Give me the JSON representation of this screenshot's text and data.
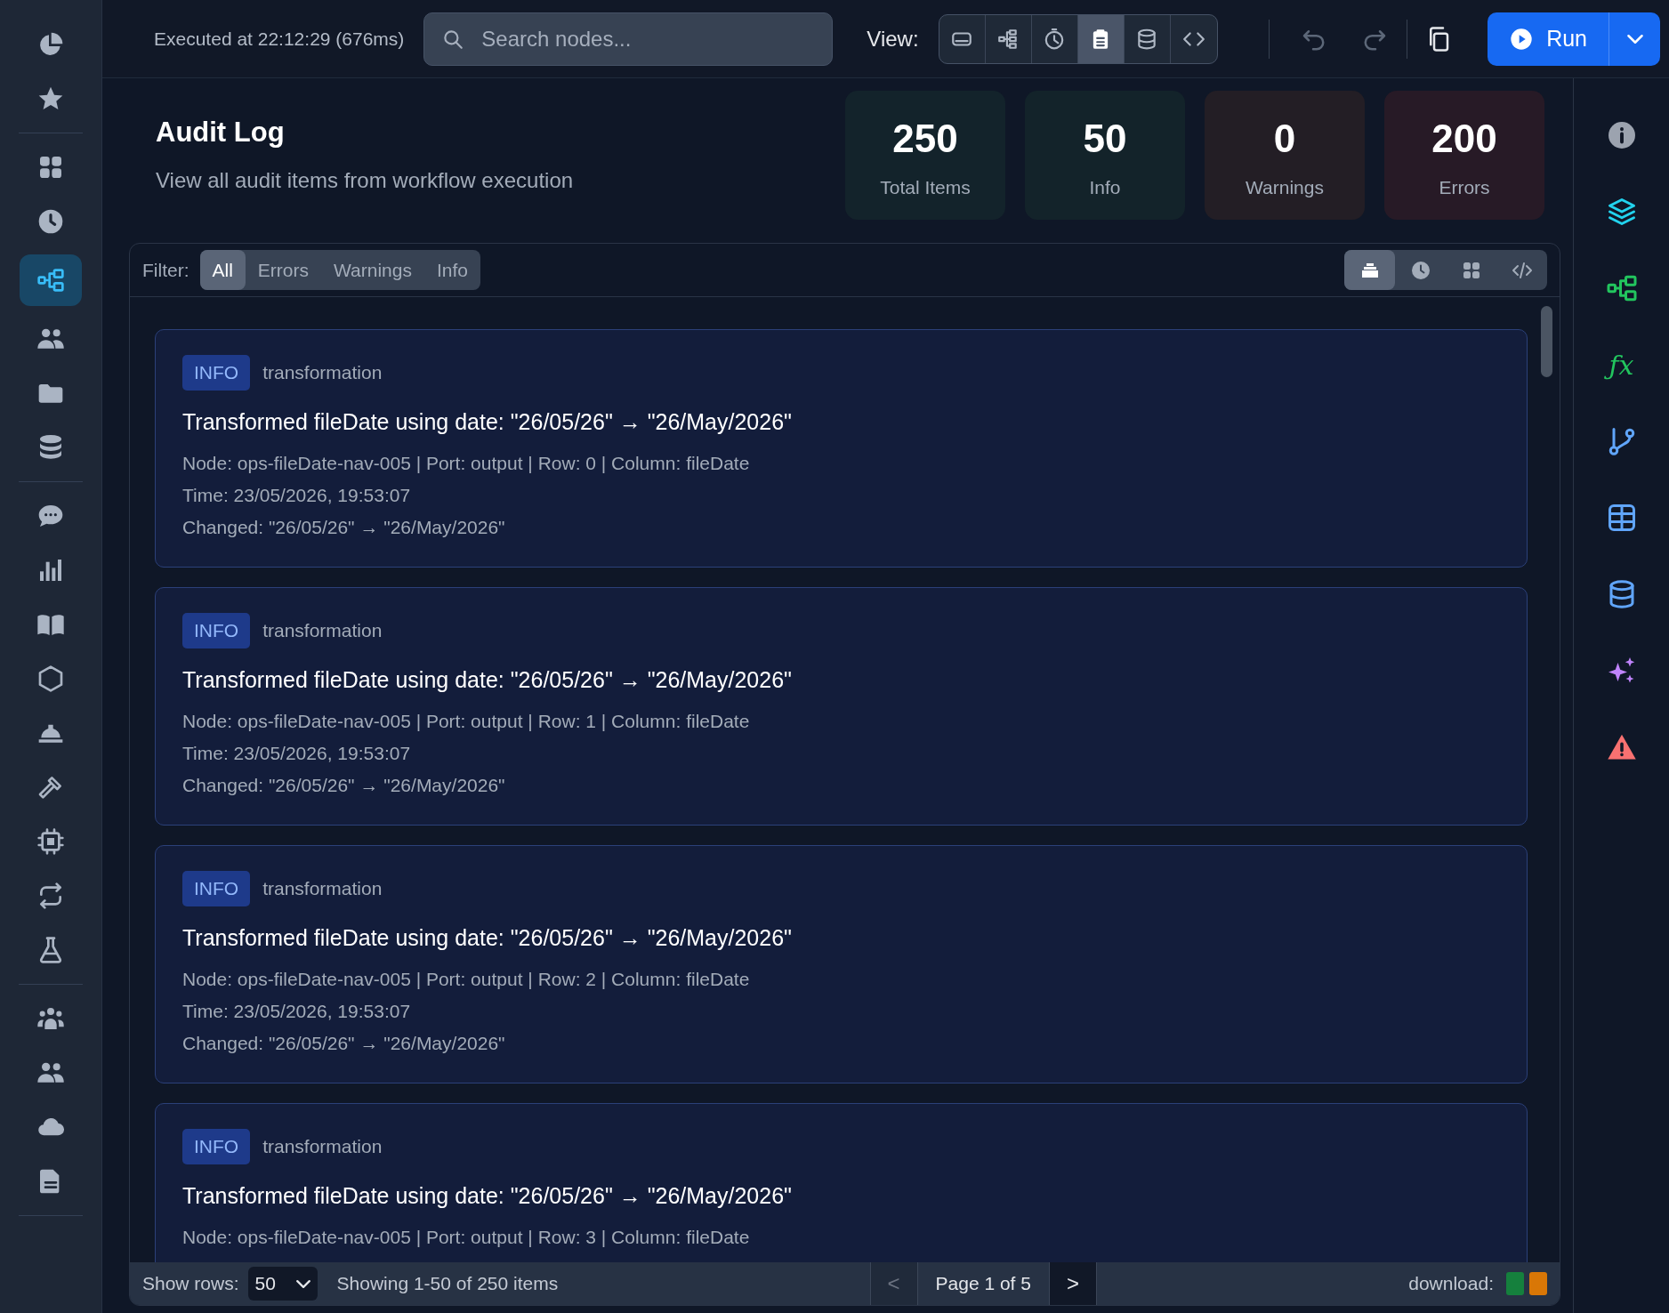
{
  "topbar": {
    "executed": "Executed at 22:12:29 (676ms)",
    "search": {
      "placeholder": "Search nodes..."
    },
    "view_label": "View:",
    "view_buttons": [
      {
        "selected": false
      },
      {
        "selected": false
      },
      {
        "selected": false
      },
      {
        "selected": true
      },
      {
        "selected": false
      },
      {
        "selected": false
      }
    ],
    "run_button": "Run"
  },
  "left_sidebar": {
    "groups": [
      [
        {
          "selected": false
        },
        {
          "selected": false
        }
      ],
      [
        {
          "selected": false
        },
        {
          "selected": false
        },
        {
          "selected": true
        },
        {
          "selected": false
        },
        {
          "selected": false
        },
        {
          "selected": false
        }
      ],
      [
        {
          "selected": false
        },
        {
          "selected": false
        },
        {
          "selected": false
        },
        {
          "selected": false
        },
        {
          "selected": false
        },
        {
          "selected": false
        },
        {
          "selected": false
        },
        {
          "selected": false
        },
        {
          "selected": false
        }
      ],
      [
        {
          "selected": false
        },
        {
          "selected": false
        },
        {
          "selected": false
        },
        {
          "selected": false
        }
      ]
    ]
  },
  "right_sidebar": {
    "function_symbol": "ƒx"
  },
  "header": {
    "title": "Audit Log",
    "subtitle": "View all audit items from workflow execution"
  },
  "stats": [
    {
      "value": "250",
      "label": "Total Items",
      "kind": "total"
    },
    {
      "value": "50",
      "label": "Info",
      "kind": "info"
    },
    {
      "value": "0",
      "label": "Warnings",
      "kind": "warning"
    },
    {
      "value": "200",
      "label": "Errors",
      "kind": "error"
    }
  ],
  "filter": {
    "label": "Filter:",
    "tabs": [
      {
        "label": "All",
        "selected": true
      },
      {
        "label": "Errors",
        "selected": false
      },
      {
        "label": "Warnings",
        "selected": false
      },
      {
        "label": "Info",
        "selected": false
      }
    ],
    "view_buttons": [
      {
        "selected": true
      },
      {
        "selected": false
      },
      {
        "selected": false
      },
      {
        "selected": false
      }
    ]
  },
  "items": [
    {
      "level": "INFO",
      "kind": "info",
      "category": "transformation",
      "title": "Transformed fileDate using date: \"26/05/26\" → \"26/May/2026\"",
      "details": [
        "Node: ops-fileDate-nav-005 | Port: output | Row: 0 | Column: fileDate",
        "Time: 23/05/2026, 19:53:07",
        "Changed: \"26/05/26\" → \"26/May/2026\""
      ]
    },
    {
      "level": "INFO",
      "kind": "info",
      "category": "transformation",
      "title": "Transformed fileDate using date: \"26/05/26\" → \"26/May/2026\"",
      "details": [
        "Node: ops-fileDate-nav-005 | Port: output | Row: 1 | Column: fileDate",
        "Time: 23/05/2026, 19:53:07",
        "Changed: \"26/05/26\" → \"26/May/2026\""
      ]
    },
    {
      "level": "INFO",
      "kind": "info",
      "category": "transformation",
      "title": "Transformed fileDate using date: \"26/05/26\" → \"26/May/2026\"",
      "details": [
        "Node: ops-fileDate-nav-005 | Port: output | Row: 2 | Column: fileDate",
        "Time: 23/05/2026, 19:53:07",
        "Changed: \"26/05/26\" → \"26/May/2026\""
      ]
    },
    {
      "level": "INFO",
      "kind": "info",
      "category": "transformation",
      "title": "Transformed fileDate using date: \"26/05/26\" → \"26/May/2026\"",
      "details": [
        "Node: ops-fileDate-nav-005 | Port: output | Row: 3 | Column: fileDate"
      ]
    }
  ],
  "footer": {
    "rows_label": "Show rows:",
    "rows_value": "50",
    "showing": "Showing 1-50 of 250 items",
    "prev": {
      "label": "<",
      "disabled": true
    },
    "page": "Page 1 of 5",
    "next": {
      "label": ">",
      "disabled": false
    },
    "download_label": "download:",
    "downloads": [
      {
        "kind": "csv"
      },
      {
        "kind": "json"
      }
    ]
  }
}
